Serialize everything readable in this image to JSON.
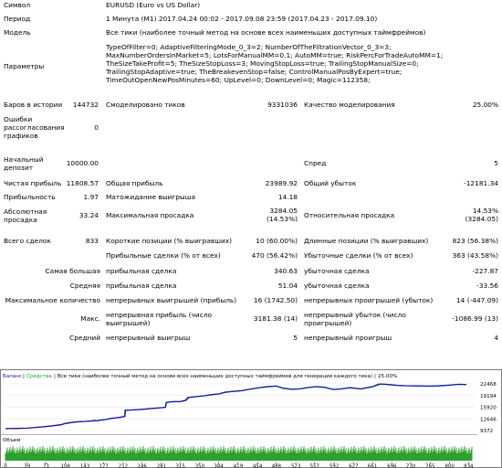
{
  "header": {
    "symbol_label": "Символ",
    "symbol_value": "EURUSD (Euro vs US Dollar)",
    "period_label": "Период",
    "period_value": "1 Минута (M1) 2017.04.24 00:02 - 2017.09.08 23:59 (2017.04.23 - 2017.09.10)",
    "model_label": "Модель",
    "model_value": "Все тики (наиболее точный метод на основе всех наименьших доступных таймфреймов)",
    "params_label": "Параметры",
    "params_lines": [
      "TypeOfFilter=0; AdaptiveFilteringMode_0_3=2; NumberOfTheFiltrationVector_0_3=3;",
      "MaxNumberOrdersInMarket=5; LotsForManualMM=0.1; AutoMM=true; RiskPercForTradeAutoMM=1;",
      "TheSizeTakeProfit=5; TheSizeStopLoss=3; MovingStopLoss=true; TrailingStopManualSize=0;",
      "TrailingStopAdaptive=true; TheBreakevenStop=false; ControlManualPosByExpert=true;",
      "TimeOutOpenNewPosMinutes=60; UpLevel=0; DownLevel=0; Magic=112358;"
    ]
  },
  "stats": {
    "bars_label": "Баров в истории",
    "bars_value": "144732",
    "ticks_label": "Смоделировано тиков",
    "ticks_value": "9331036",
    "quality_label": "Качество моделирования",
    "quality_value": "25.00%",
    "errors_label": "Ошибки рассогласования графиков",
    "errors_value": "0",
    "deposit_label": "Начальный депозит",
    "deposit_value": "10000.00",
    "spread_label": "Спред",
    "spread_value": "5",
    "net_label": "Чистая прибыль",
    "net_value": "11808.57",
    "gross_profit_label": "Общая прибыль",
    "gross_profit_value": "23989.92",
    "gross_loss_label": "Общий убыток",
    "gross_loss_value": "-12181.34",
    "pf_label": "Прибыльность",
    "pf_value": "1.97",
    "expected_label": "Матожидание выигрыша",
    "expected_value": "14.18",
    "abs_dd_label": "Абсолютная просадка",
    "abs_dd_value": "33.24",
    "max_dd_label": "Максимальная просадка",
    "max_dd_value": "3284.05",
    "max_dd_pct": "(14.53%)",
    "rel_dd_label": "Относительная просадка",
    "rel_dd_value": "14.53%",
    "rel_dd_sub": "(3284.05)",
    "trades_label": "Всего сделок",
    "trades_value": "833",
    "short_label": "Короткие позиции (% выигравших)",
    "short_value": "10 (60.00%)",
    "long_label": "Длинные позиции (% выигравших)",
    "long_value": "823 (56.38%)",
    "profit_trades_label": "Прибыльные сделки (% от всех)",
    "profit_trades_value": "470 (56.42%)",
    "loss_trades_label": "Убыточные сделки (% от всех)",
    "loss_trades_value": "363 (43.58%)",
    "largest_label": "Самая большая",
    "largest_profit_label": "прибыльная сделка",
    "largest_profit_value": "340.63",
    "largest_loss_label": "убыточная сделка",
    "largest_loss_value": "-227.87",
    "average_label": "Средняя",
    "average_profit_label": "прибыльная сделка",
    "average_profit_value": "51.04",
    "average_loss_label": "убыточная сделка",
    "average_loss_value": "-33.56",
    "maxcount_label": "Максимальное количество",
    "cons_wins_label": "непрерывных выигрышей (прибыль)",
    "cons_wins_value": "16 (1742.50)",
    "cons_losses_label": "непрерывных проигрышей (убыток)",
    "cons_losses_value": "14 (-447.09)",
    "max_label": "Макс.",
    "cons_profit_label": "непрерывная прибыль (число выигрышей)",
    "cons_profit_value": "3181.38 (14)",
    "cons_loss_label": "непрерывный убыток (число проигрышей)",
    "cons_loss_value": "-1086.99 (13)",
    "avg_label": "Средний",
    "avg_wins_label": "непрерывный выигрыш",
    "avg_wins_value": "5",
    "avg_losses_label": "непрерывный проигрыш",
    "avg_losses_value": "4"
  },
  "chart_data": {
    "type": "line",
    "legend": [
      "Баланс",
      "Средства",
      "Все тики (наиболее точный метод на основе всех наименьших доступных таймфреймов для генерации каждого тика)",
      "25.00%"
    ],
    "volume_label": "Объем",
    "y_ticks": [
      "22468",
      "19194",
      "15920",
      "12646",
      "9372"
    ],
    "ylim": [
      9372,
      22468
    ],
    "x_ticks": [
      "0",
      "39",
      "73",
      "108",
      "143",
      "177",
      "212",
      "246",
      "281",
      "315",
      "350",
      "384",
      "419",
      "454",
      "488",
      "523",
      "557",
      "592",
      "627",
      "661",
      "696",
      "730",
      "765",
      "800",
      "834"
    ],
    "xlim": [
      0,
      845
    ],
    "colors": {
      "balance": "#1414a8",
      "equity": "#13a013",
      "volume": "#2ea02e",
      "text": "#000000"
    },
    "balance": [
      [
        0,
        9900
      ],
      [
        20,
        9950
      ],
      [
        40,
        10050
      ],
      [
        55,
        10250
      ],
      [
        70,
        10450
      ],
      [
        85,
        10700
      ],
      [
        100,
        11000
      ],
      [
        108,
        11350
      ],
      [
        118,
        11600
      ],
      [
        132,
        11850
      ],
      [
        145,
        11950
      ],
      [
        165,
        12150
      ],
      [
        180,
        12450
      ],
      [
        190,
        12750
      ],
      [
        205,
        13050
      ],
      [
        215,
        13300
      ],
      [
        216,
        15050
      ],
      [
        230,
        15150
      ],
      [
        250,
        15350
      ],
      [
        270,
        15650
      ],
      [
        288,
        15900
      ],
      [
        290,
        17250
      ],
      [
        300,
        17450
      ],
      [
        315,
        17500
      ],
      [
        325,
        17850
      ],
      [
        330,
        18650
      ],
      [
        345,
        18900
      ],
      [
        360,
        19150
      ],
      [
        370,
        19450
      ],
      [
        385,
        19650
      ],
      [
        395,
        20100
      ],
      [
        410,
        20350
      ],
      [
        425,
        20550
      ],
      [
        440,
        20950
      ],
      [
        455,
        21350
      ],
      [
        470,
        21650
      ],
      [
        488,
        21850
      ],
      [
        500,
        21250
      ],
      [
        515,
        20950
      ],
      [
        530,
        21050
      ],
      [
        545,
        21450
      ],
      [
        560,
        21700
      ],
      [
        575,
        21500
      ],
      [
        590,
        20900
      ],
      [
        605,
        21050
      ],
      [
        620,
        21400
      ],
      [
        640,
        21050
      ],
      [
        660,
        21650
      ],
      [
        675,
        22450
      ],
      [
        690,
        22300
      ],
      [
        705,
        22050
      ],
      [
        720,
        21950
      ],
      [
        740,
        21900
      ],
      [
        760,
        21850
      ],
      [
        780,
        21900
      ],
      [
        800,
        22100
      ],
      [
        815,
        22350
      ],
      [
        830,
        22300
      ]
    ],
    "equity": [
      [
        0,
        9900
      ],
      [
        20,
        9950
      ],
      [
        40,
        10050
      ],
      [
        55,
        10250
      ],
      [
        70,
        10450
      ],
      [
        85,
        10700
      ],
      [
        100,
        11100
      ],
      [
        108,
        11400
      ],
      [
        118,
        11650
      ],
      [
        132,
        11850
      ],
      [
        145,
        11950
      ],
      [
        160,
        12250
      ],
      [
        165,
        12100
      ],
      [
        180,
        12500
      ],
      [
        190,
        12800
      ],
      [
        205,
        13100
      ],
      [
        214,
        13300
      ],
      [
        215,
        15100
      ],
      [
        230,
        15200
      ],
      [
        250,
        15400
      ],
      [
        270,
        15700
      ],
      [
        288,
        15950
      ],
      [
        289,
        17300
      ],
      [
        300,
        17500
      ],
      [
        315,
        17550
      ],
      [
        324,
        17900
      ],
      [
        328,
        18700
      ],
      [
        345,
        18950
      ],
      [
        360,
        19200
      ],
      [
        370,
        19500
      ],
      [
        385,
        19700
      ],
      [
        395,
        20150
      ],
      [
        410,
        20400
      ],
      [
        425,
        20600
      ],
      [
        440,
        21000
      ],
      [
        455,
        21400
      ],
      [
        470,
        21700
      ],
      [
        488,
        21900
      ],
      [
        500,
        21300
      ],
      [
        515,
        21000
      ],
      [
        530,
        21100
      ],
      [
        545,
        21500
      ],
      [
        560,
        21750
      ],
      [
        575,
        21550
      ],
      [
        590,
        20950
      ],
      [
        605,
        21100
      ],
      [
        620,
        21450
      ],
      [
        640,
        21100
      ],
      [
        660,
        21700
      ],
      [
        672,
        22500
      ],
      [
        690,
        22350
      ],
      [
        705,
        22100
      ],
      [
        720,
        21950
      ],
      [
        740,
        21900
      ],
      [
        760,
        21850
      ],
      [
        780,
        21950
      ],
      [
        800,
        22150
      ],
      [
        815,
        22400
      ],
      [
        830,
        22350
      ]
    ]
  }
}
